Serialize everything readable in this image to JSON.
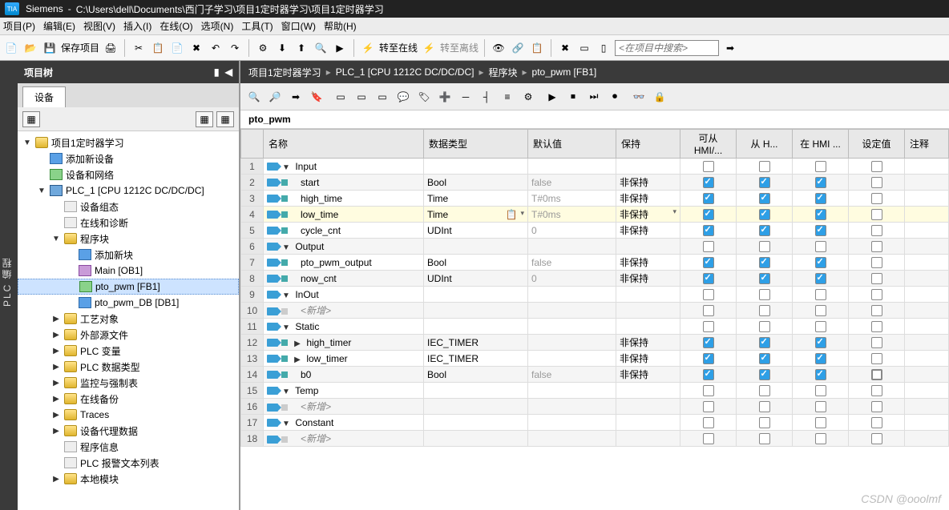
{
  "title_bar": {
    "app": "Siemens",
    "path": "C:\\Users\\dell\\Documents\\西门子学习\\项目1定时器学习\\项目1定时器学习"
  },
  "menu": [
    "项目(P)",
    "编辑(E)",
    "视图(V)",
    "插入(I)",
    "在线(O)",
    "选项(N)",
    "工具(T)",
    "窗口(W)",
    "帮助(H)"
  ],
  "main_toolbar": {
    "save_label": "保存项目",
    "go_online": "转至在线",
    "go_offline": "转至离线",
    "search_placeholder": "<在项目中搜索>"
  },
  "side_label": "PLC 编程",
  "project_tree": {
    "title": "项目树",
    "tab": "设备",
    "items": [
      {
        "indent": 0,
        "exp": "▼",
        "icon": "folder",
        "label": "项目1定时器学习"
      },
      {
        "indent": 1,
        "exp": "",
        "icon": "device",
        "label": "添加新设备"
      },
      {
        "indent": 1,
        "exp": "",
        "icon": "net",
        "label": "设备和网络"
      },
      {
        "indent": 1,
        "exp": "▼",
        "icon": "cpu",
        "label": "PLC_1 [CPU 1212C DC/DC/DC]"
      },
      {
        "indent": 2,
        "exp": "",
        "icon": "doc",
        "label": "设备组态"
      },
      {
        "indent": 2,
        "exp": "",
        "icon": "doc",
        "label": "在线和诊断"
      },
      {
        "indent": 2,
        "exp": "▼",
        "icon": "folder",
        "label": "程序块"
      },
      {
        "indent": 3,
        "exp": "",
        "icon": "device",
        "label": "添加新块"
      },
      {
        "indent": 3,
        "exp": "",
        "icon": "block-p",
        "label": "Main [OB1]"
      },
      {
        "indent": 3,
        "exp": "",
        "icon": "block-g",
        "label": "pto_pwm [FB1]",
        "selected": true
      },
      {
        "indent": 3,
        "exp": "",
        "icon": "block-b",
        "label": "pto_pwm_DB [DB1]"
      },
      {
        "indent": 2,
        "exp": "▶",
        "icon": "folder",
        "label": "工艺对象"
      },
      {
        "indent": 2,
        "exp": "▶",
        "icon": "folder",
        "label": "外部源文件"
      },
      {
        "indent": 2,
        "exp": "▶",
        "icon": "folder",
        "label": "PLC 变量"
      },
      {
        "indent": 2,
        "exp": "▶",
        "icon": "folder",
        "label": "PLC 数据类型"
      },
      {
        "indent": 2,
        "exp": "▶",
        "icon": "folder",
        "label": "监控与强制表"
      },
      {
        "indent": 2,
        "exp": "▶",
        "icon": "folder",
        "label": "在线备份"
      },
      {
        "indent": 2,
        "exp": "▶",
        "icon": "folder",
        "label": "Traces"
      },
      {
        "indent": 2,
        "exp": "▶",
        "icon": "folder",
        "label": "设备代理数据"
      },
      {
        "indent": 2,
        "exp": "",
        "icon": "doc",
        "label": "程序信息"
      },
      {
        "indent": 2,
        "exp": "",
        "icon": "doc",
        "label": "PLC 报警文本列表"
      },
      {
        "indent": 2,
        "exp": "▶",
        "icon": "folder",
        "label": "本地模块"
      }
    ]
  },
  "breadcrumb": [
    "项目1定时器学习",
    "PLC_1 [CPU 1212C DC/DC/DC]",
    "程序块",
    "pto_pwm [FB1]"
  ],
  "block_name": "pto_pwm",
  "var_table": {
    "columns": [
      "",
      "名称",
      "数据类型",
      "默认值",
      "保持",
      "可从 HMI/...",
      "从 H...",
      "在 HMI ...",
      "设定值",
      "注释"
    ],
    "rows": [
      {
        "n": 1,
        "type": "section",
        "exp": "▼",
        "name": "Input"
      },
      {
        "n": 2,
        "type": "var",
        "name": "start",
        "dtype": "Bool",
        "def": "false",
        "retain": "非保持",
        "c1": true,
        "c2": true,
        "c3": true
      },
      {
        "n": 3,
        "type": "var",
        "name": "high_time",
        "dtype": "Time",
        "def": "T#0ms",
        "retain": "非保持",
        "c1": true,
        "c2": true,
        "c3": true
      },
      {
        "n": 4,
        "type": "var",
        "name": "low_time",
        "dtype": "Time",
        "def": "T#0ms",
        "retain": "非保持",
        "c1": true,
        "c2": true,
        "c3": true,
        "dd": true,
        "highlight": true
      },
      {
        "n": 5,
        "type": "var",
        "name": "cycle_cnt",
        "dtype": "UDInt",
        "def": "0",
        "retain": "非保持",
        "c1": true,
        "c2": true,
        "c3": true
      },
      {
        "n": 6,
        "type": "section",
        "exp": "▼",
        "name": "Output"
      },
      {
        "n": 7,
        "type": "var",
        "name": "pto_pwm_output",
        "dtype": "Bool",
        "def": "false",
        "retain": "非保持",
        "c1": true,
        "c2": true,
        "c3": true
      },
      {
        "n": 8,
        "type": "var",
        "name": "now_cnt",
        "dtype": "UDInt",
        "def": "0",
        "retain": "非保持",
        "c1": true,
        "c2": true,
        "c3": true
      },
      {
        "n": 9,
        "type": "section",
        "exp": "▼",
        "name": "InOut"
      },
      {
        "n": 10,
        "type": "new",
        "name": "<新增>"
      },
      {
        "n": 11,
        "type": "section",
        "exp": "▼",
        "name": "Static"
      },
      {
        "n": 12,
        "type": "struct",
        "exp": "▶",
        "name": "high_timer",
        "dtype": "IEC_TIMER",
        "retain": "非保持",
        "c1": true,
        "c2": true,
        "c3": true
      },
      {
        "n": 13,
        "type": "struct",
        "exp": "▶",
        "name": "low_timer",
        "dtype": "IEC_TIMER",
        "retain": "非保持",
        "c1": true,
        "c2": true,
        "c3": true
      },
      {
        "n": 14,
        "type": "var",
        "name": "b0",
        "dtype": "Bool",
        "def": "false",
        "retain": "非保持",
        "c1": true,
        "c2": true,
        "c3": true,
        "setv": true
      },
      {
        "n": 15,
        "type": "section",
        "exp": "▼",
        "name": "Temp"
      },
      {
        "n": 16,
        "type": "new",
        "name": "<新增>"
      },
      {
        "n": 17,
        "type": "section",
        "exp": "▼",
        "name": "Constant"
      },
      {
        "n": 18,
        "type": "new",
        "name": "<新增>"
      }
    ]
  },
  "watermark": "CSDN @ooolmf"
}
